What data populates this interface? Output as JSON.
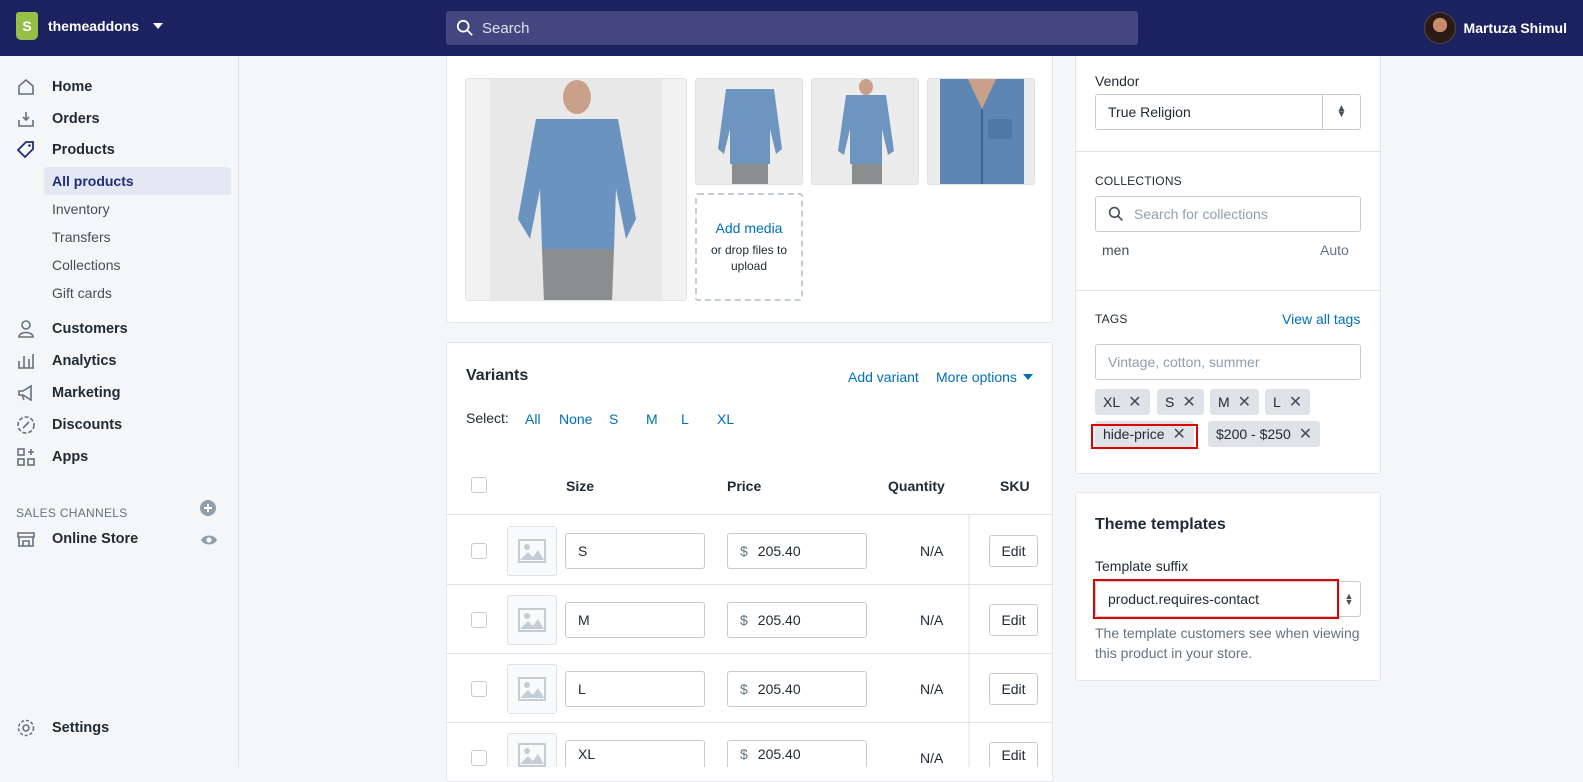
{
  "topbar": {
    "store_name": "themeaddons",
    "search_placeholder": "Search",
    "user_name": "Martuza Shimul"
  },
  "sidebar": {
    "home": "Home",
    "orders": "Orders",
    "products": "Products",
    "sub_items": [
      "All products",
      "Inventory",
      "Transfers",
      "Collections",
      "Gift cards"
    ],
    "customers": "Customers",
    "analytics": "Analytics",
    "marketing": "Marketing",
    "discounts": "Discounts",
    "apps": "Apps",
    "sales_channels_title": "SALES CHANNELS",
    "online_store": "Online Store",
    "settings": "Settings"
  },
  "media": {
    "add_media": "Add media",
    "drop_text": "or drop files to upload"
  },
  "variants": {
    "title": "Variants",
    "add_variant": "Add variant",
    "more_options": "More options",
    "select_label": "Select:",
    "select_options": [
      "All",
      "None",
      "S",
      "M",
      "L",
      "XL"
    ],
    "headers": {
      "size": "Size",
      "price": "Price",
      "quantity": "Quantity",
      "sku": "SKU"
    },
    "rows": [
      {
        "size": "S",
        "currency": "$",
        "price": "205.40",
        "quantity": "N/A",
        "edit": "Edit"
      },
      {
        "size": "M",
        "currency": "$",
        "price": "205.40",
        "quantity": "N/A",
        "edit": "Edit"
      },
      {
        "size": "L",
        "currency": "$",
        "price": "205.40",
        "quantity": "N/A",
        "edit": "Edit"
      },
      {
        "size": "XL",
        "currency": "$",
        "price": "205.40",
        "quantity": "N/A",
        "edit": "Edit"
      }
    ]
  },
  "organization": {
    "vendor_label": "Vendor",
    "vendor_value": "True Religion",
    "collections_title": "COLLECTIONS",
    "collections_placeholder": "Search for collections",
    "collection_name": "men",
    "collection_type": "Auto",
    "tags_title": "TAGS",
    "view_all_tags": "View all tags",
    "tags_placeholder": "Vintage, cotton, summer",
    "tags": [
      "XL",
      "S",
      "M",
      "L",
      "hide-price",
      "$200 - $250"
    ]
  },
  "theme_templates": {
    "title": "Theme templates",
    "suffix_label": "Template suffix",
    "suffix_value": "product.requires-contact",
    "help_text": "The template customers see when viewing this product in your store."
  },
  "colors": {
    "topbar": "#1c2260",
    "link": "#006fbb",
    "active_nav": "#202e78",
    "highlight": "#e00000"
  }
}
